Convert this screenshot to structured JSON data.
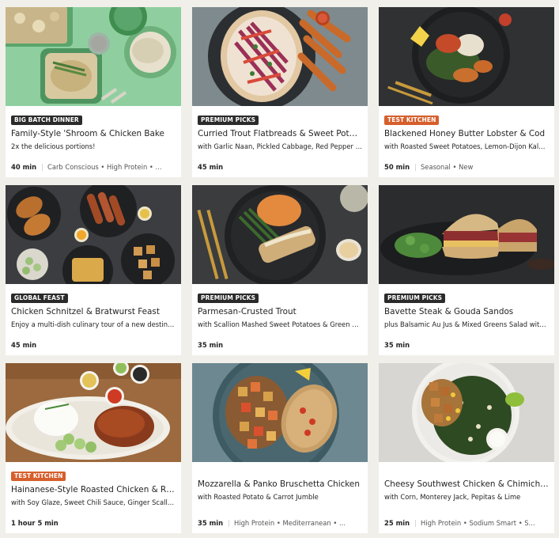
{
  "colors": {
    "page_bg": "#f1efe9",
    "card_bg": "#ffffff",
    "badge_dark": "#2b2b2b",
    "badge_orange": "#d65f2c"
  },
  "recipes": [
    {
      "badge": "BIG BATCH DINNER",
      "badge_style": "dark",
      "title": "Family-Style 'Shroom & Chicken Bake",
      "subtitle": "2x the delicious portions!",
      "time": "40 min",
      "tags": "Carb Conscious • High Protein • ...",
      "image": "green-table-casserole-photo"
    },
    {
      "badge": "PREMIUM PICKS",
      "badge_style": "dark",
      "title": "Curried Trout Flatbreads & Sweet Potato...",
      "subtitle": "with Garlic Naan, Pickled Cabbage, Red Pepper Chu...",
      "time": "45 min",
      "tags": "",
      "image": "flatbread-sweet-potato-photo"
    },
    {
      "badge": "TEST KITCHEN",
      "badge_style": "orange",
      "title": "Blackened Honey Butter Lobster & Cod",
      "subtitle": "with Roasted Sweet Potatoes, Lemon-Dijon Kale & ...",
      "time": "50 min",
      "tags": "Seasonal • New",
      "image": "lobster-cod-plate-photo"
    },
    {
      "badge": "GLOBAL FEAST",
      "badge_style": "dark",
      "title": "Chicken Schnitzel & Bratwurst Feast",
      "subtitle": "Enjoy a multi-dish culinary tour of a new destination!",
      "time": "45 min",
      "tags": "",
      "image": "schnitzel-bratwurst-spread-photo"
    },
    {
      "badge": "PREMIUM PICKS",
      "badge_style": "dark",
      "title": "Parmesan-Crusted Trout",
      "subtitle": "with Scallion Mashed Sweet Potatoes & Green Bean...",
      "time": "35 min",
      "tags": "",
      "image": "parmesan-trout-plate-photo"
    },
    {
      "badge": "PREMIUM PICKS",
      "badge_style": "dark",
      "title": "Bavette Steak & Gouda Sandos",
      "subtitle": "plus Balsamic Au Jus & Mixed Greens Salad with Ap...",
      "time": "35 min",
      "tags": "",
      "image": "steak-sandwich-photo"
    },
    {
      "badge": "TEST KITCHEN",
      "badge_style": "orange",
      "title": "Hainanese-Style Roasted Chicken & Rice",
      "subtitle": "with Soy Glaze, Sweet Chili Sauce, Ginger Scallion S...",
      "time": "1 hour 5 min",
      "tags": "",
      "image": "roasted-chicken-rice-photo"
    },
    {
      "badge": "",
      "badge_style": "dark",
      "title": "Mozzarella & Panko Bruschetta Chicken",
      "subtitle": "with Roasted Potato & Carrot Jumble",
      "time": "35 min",
      "tags": "High Protein • Mediterranean • ...",
      "image": "bruschetta-chicken-plate-photo"
    },
    {
      "badge": "",
      "badge_style": "dark",
      "title": "Cheesy Southwest Chicken & Chimichur...",
      "subtitle": "with Corn, Monterey Jack, Pepitas & Lime",
      "time": "25 min",
      "tags": "High Protein • Sodium Smart • S...",
      "image": "southwest-chicken-bowl-photo"
    }
  ]
}
